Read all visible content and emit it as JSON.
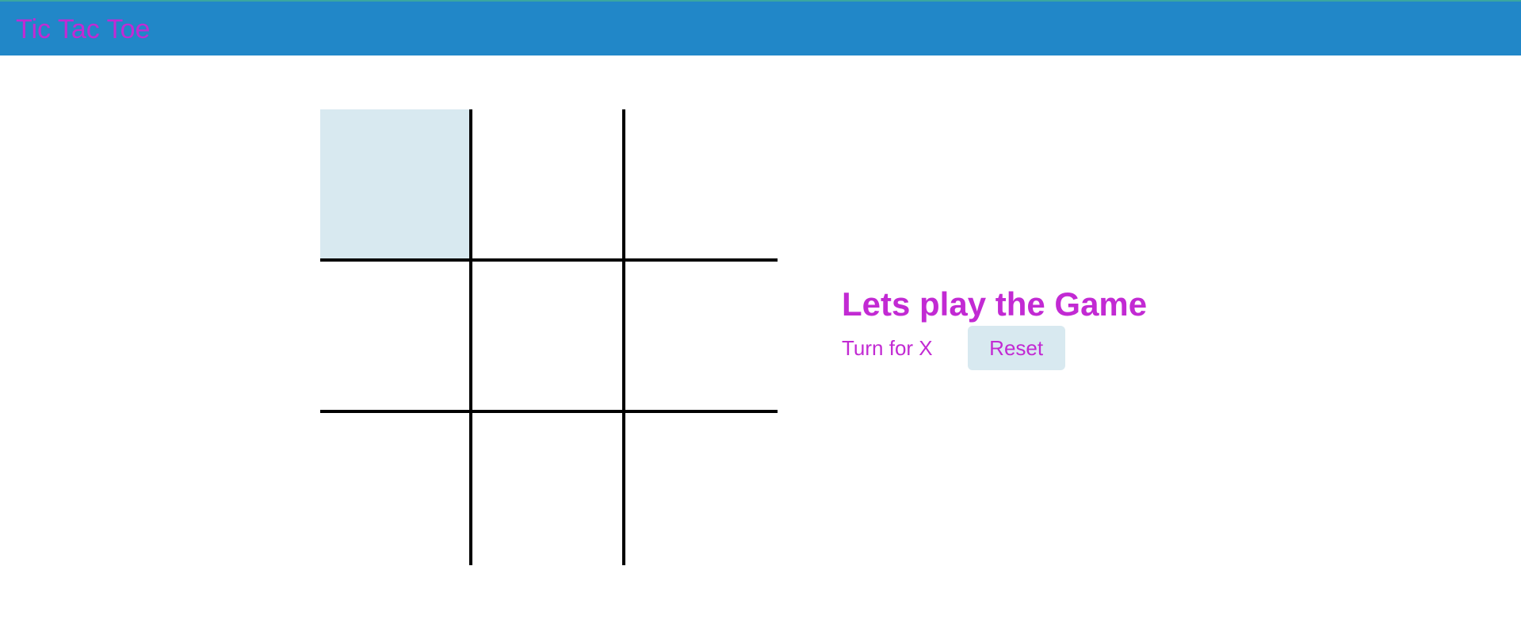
{
  "app": {
    "title": "Tic Tac Toe"
  },
  "colors": {
    "header_bg": "#2187c8",
    "accent_text": "#c22ad3",
    "highlight_cell": "#d8e9f0",
    "grid_lines": "#000000"
  },
  "board": {
    "cells": [
      "",
      "",
      "",
      "",
      "",
      "",
      "",
      "",
      ""
    ],
    "highlighted_cell": 0
  },
  "panel": {
    "heading": "Lets play the Game",
    "turn_text": "Turn for X",
    "reset_label": "Reset"
  }
}
